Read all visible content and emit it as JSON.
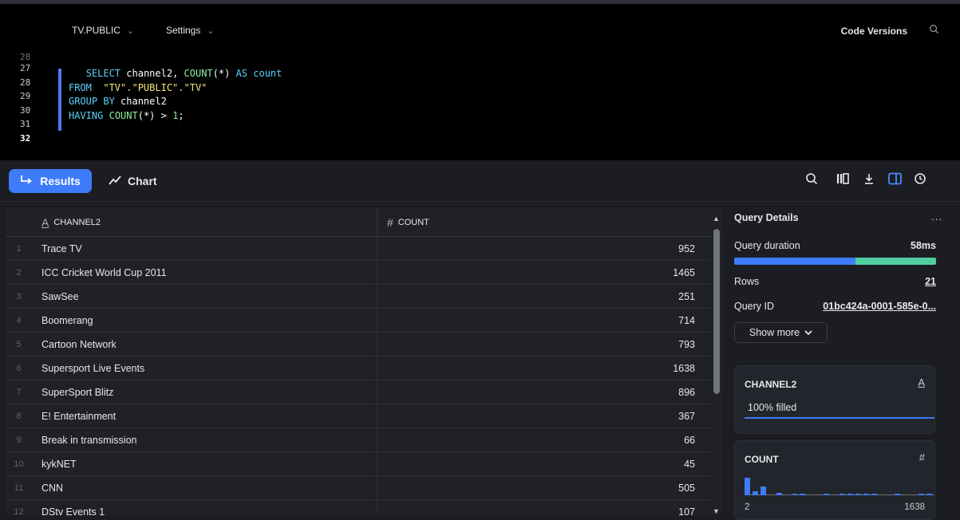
{
  "editor": {
    "database_label": "TV.PUBLIC",
    "settings_label": "Settings",
    "code_versions_label": "Code Versions",
    "line_numbers": [
      "28",
      "27",
      "28",
      "29",
      "30",
      "31",
      "32"
    ],
    "code_lines": [
      "   SELECT channel2, COUNT(*) AS count",
      "FROM  \"TV\".\"PUBLIC\".\"TV\"",
      "GROUP BY channel2",
      "HAVING COUNT(*) > 1;"
    ]
  },
  "results_bar": {
    "results_label": "Results",
    "chart_label": "Chart"
  },
  "grid": {
    "columns": [
      {
        "name": "CHANNEL2",
        "type_icon": "text-type-icon"
      },
      {
        "name": "COUNT",
        "type_icon": "number-type-icon"
      }
    ],
    "rows": [
      {
        "idx": "1",
        "channel": "Trace TV",
        "count": "952"
      },
      {
        "idx": "2",
        "channel": "ICC Cricket World Cup 2011",
        "count": "1465"
      },
      {
        "idx": "3",
        "channel": "SawSee",
        "count": "251"
      },
      {
        "idx": "4",
        "channel": "Boomerang",
        "count": "714"
      },
      {
        "idx": "5",
        "channel": "Cartoon Network",
        "count": "793"
      },
      {
        "idx": "6",
        "channel": "Supersport Live Events",
        "count": "1638"
      },
      {
        "idx": "7",
        "channel": "SuperSport Blitz",
        "count": "896"
      },
      {
        "idx": "8",
        "channel": "E! Entertainment",
        "count": "367"
      },
      {
        "idx": "9",
        "channel": "Break in transmission",
        "count": "66"
      },
      {
        "idx": "10",
        "channel": "kykNET",
        "count": "45"
      },
      {
        "idx": "11",
        "channel": "CNN",
        "count": "505"
      },
      {
        "idx": "12",
        "channel": "DStv Events 1",
        "count": "107"
      }
    ]
  },
  "details": {
    "title": "Query Details",
    "more_label": "...",
    "duration_label": "Query duration",
    "duration_value": "58ms",
    "duration_split_fraction": 0.6,
    "rows_label": "Rows",
    "rows_value": "21",
    "query_id_label": "Query ID",
    "query_id_value": "01bc424a-0001-585e-0...",
    "show_more_label": "Show more",
    "channel_card": {
      "title": "CHANNEL2",
      "filled": "100% filled"
    },
    "count_card": {
      "title": "COUNT",
      "min": "2",
      "max": "1638",
      "histogram": [
        1.0,
        0.25,
        0.5,
        0,
        0.12,
        0,
        0.1,
        0.1,
        0,
        0,
        0.1,
        0,
        0.1,
        0.1,
        0.1,
        0.1,
        0.1,
        0,
        0,
        0.1,
        0,
        0,
        0.1,
        0.1
      ]
    }
  }
}
